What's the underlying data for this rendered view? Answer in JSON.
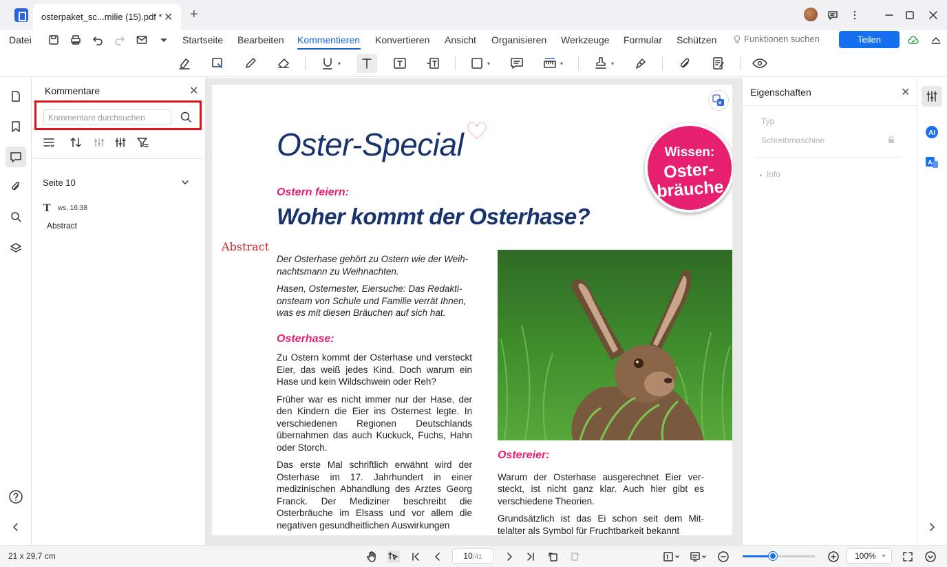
{
  "window": {
    "tab_title": "osterpaket_sc...milie (15).pdf *",
    "tab_close": "✕",
    "new_tab": "+"
  },
  "menu": {
    "file": "Datei",
    "items": [
      "Startseite",
      "Bearbeiten",
      "Kommentieren",
      "Konvertieren",
      "Ansicht",
      "Organisieren",
      "Werkzeuge",
      "Formular",
      "Schützen"
    ],
    "active": "Kommentieren",
    "feature_search": "Funktionen suchen",
    "share": "Teilen"
  },
  "comments_panel": {
    "title": "Kommentare",
    "close": "✕",
    "search_placeholder": "Kommentare durchsuchen",
    "page_group": "Seite 10",
    "comment": {
      "type_icon": "T",
      "meta": "ws, 16:38",
      "text": "Abstract"
    }
  },
  "document": {
    "title": "Oster-Special",
    "badge_line1": "Wissen:",
    "badge_line2": "Oster-\nbräuche",
    "kicker": "Ostern feiern:",
    "headline": "Woher kommt der Osterhase?",
    "annotation": "Abstract",
    "intro": [
      "Der Osterhase gehört zu Ostern wie der Weih-nachtsmann zu Weihnachten.",
      "Hasen, Osternester, Eiersuche: Das Redakti-onsteam von Schule und Familie verrät Ihnen, was es mit diesen Bräuchen auf sich hat."
    ],
    "section1_title": "Osterhase:",
    "section1": [
      "Zu Ostern kommt der Osterhase und versteckt Eier, das weiß jedes Kind. Doch warum ein Hase und kein Wildschwein oder Reh?",
      "Früher war es nicht immer nur der Hase, der den Kindern die Eier ins Osternest legte. In verschiedenen Regionen Deutschlands übernahmen das auch Kuckuck, Fuchs, Hahn oder Storch.",
      "Das erste Mal schriftlich erwähnt wird der Osterhase im 17. Jahrhundert in einer medizinischen Abhandlung des Arztes Georg Franck. Der Mediziner beschreibt die Osterbräuche im Elsass und vor allem die negativen gesundheitlichen Auswirkungen"
    ],
    "section2_title": "Ostereier:",
    "section2": [
      "Warum der Osterhase ausgerechnet Eier ver-steckt, ist nicht ganz klar. Auch hier gibt es verschiedene Theorien.",
      "Grundsätzlich ist das Ei schon seit dem Mit-telalter als Symbol für Fruchtbarkeit bekannt"
    ]
  },
  "properties": {
    "title": "Eigenschaften",
    "close": "✕",
    "type_label": "Typ",
    "type_value": "Schreibmaschine",
    "info": "Info"
  },
  "status": {
    "page_size": "21 x 29,7 cm",
    "current_page": "10",
    "total_pages": "/41",
    "zoom": "100%",
    "zoom_level": 0.42
  },
  "colors": {
    "accent": "#1570ef",
    "magenta": "#e6206e",
    "navy": "#19336e",
    "highlight_box": "#e0141a"
  }
}
